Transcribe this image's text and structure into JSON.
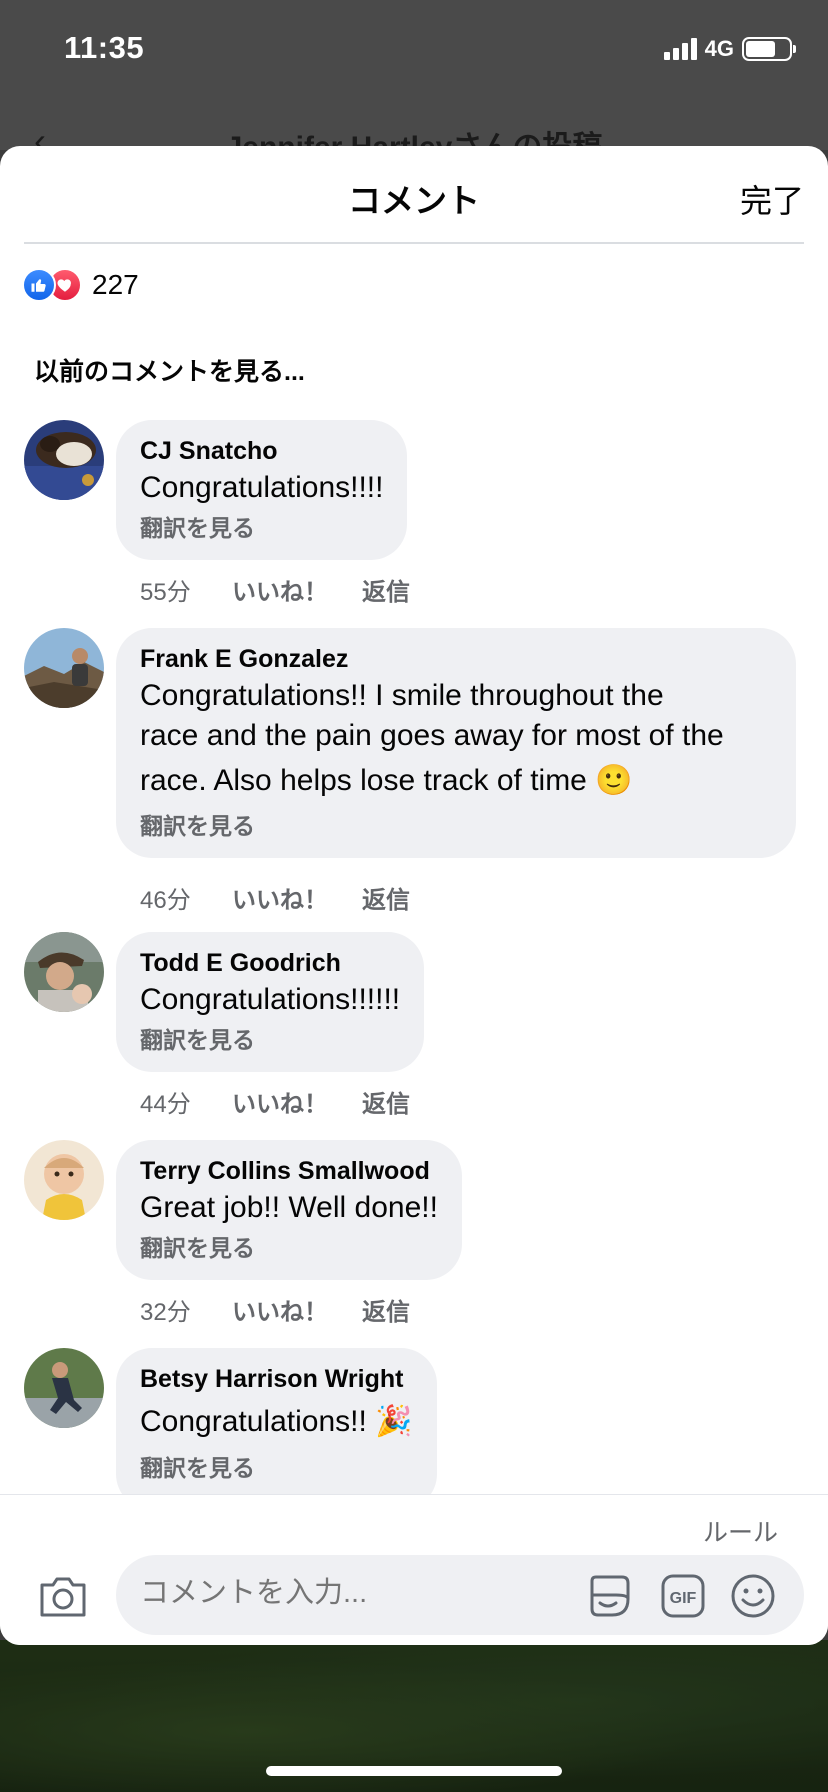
{
  "status_bar": {
    "time": "11:35",
    "network": "4G"
  },
  "background": {
    "back_glyph": "‹",
    "title": "Jennifer Hartleyさんの投稿"
  },
  "sheet": {
    "title": "コメント",
    "done_label": "完了"
  },
  "reactions": {
    "count": "227",
    "icons": [
      "like-icon",
      "love-icon"
    ]
  },
  "previous_comments_label": "以前のコメントを見る...",
  "comments": [
    {
      "name": "CJ Snatcho",
      "lines": [
        "Congratulations!!!!"
      ],
      "translate": "翻訳を見る",
      "time": "55分",
      "like": "いいね！",
      "reply": "返信"
    },
    {
      "name": "Frank E Gonzalez",
      "lines": [
        "Congratulations!! I smile throughout the",
        "race and the pain goes away for most of the",
        "race. Also helps lose track of time 🙂"
      ],
      "translate": "翻訳を見る",
      "time": "46分",
      "like": "いいね！",
      "reply": "返信"
    },
    {
      "name": "Todd E Goodrich",
      "lines": [
        "Congratulations!!!!!!"
      ],
      "translate": "翻訳を見る",
      "time": "44分",
      "like": "いいね！",
      "reply": "返信"
    },
    {
      "name": "Terry Collins Smallwood",
      "lines": [
        "Great job!! Well done!!"
      ],
      "translate": "翻訳を見る",
      "time": "32分",
      "like": "いいね！",
      "reply": "返信"
    },
    {
      "name": "Betsy Harrison Wright",
      "lines": [
        "Congratulations!! 🎉"
      ],
      "translate": "翻訳を見る"
    }
  ],
  "composer": {
    "rules_label": "ルール",
    "placeholder": "コメントを入力...",
    "gif_label": "GIF"
  },
  "colors": {
    "bubble": "#eff0f3",
    "secondary_text": "#65676b",
    "like_blue": "#1877f2",
    "love_red": "#e41e3f"
  }
}
